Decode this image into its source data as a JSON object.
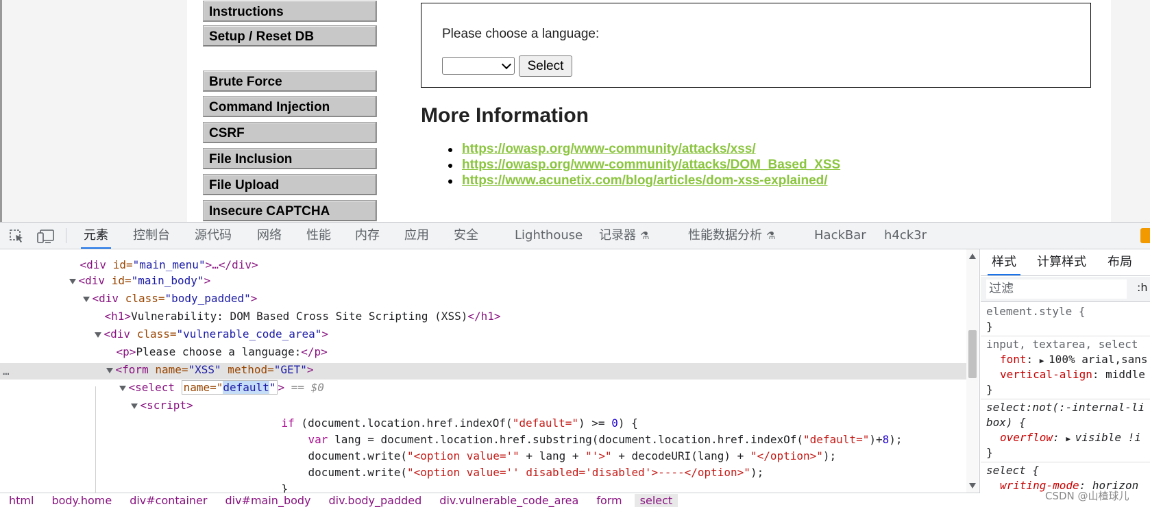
{
  "page": {
    "menu": [
      "Instructions",
      "Setup / Reset DB",
      "Brute Force",
      "Command Injection",
      "CSRF",
      "File Inclusion",
      "File Upload",
      "Insecure CAPTCHA"
    ],
    "prompt": "Please choose a language:",
    "select_button": "Select",
    "more_info_heading": "More Information",
    "links": [
      "https://owasp.org/www-community/attacks/xss/",
      "https://owasp.org/www-community/attacks/DOM_Based_XSS",
      "https://www.acunetix.com/blog/articles/dom-xss-explained/"
    ],
    "colors": {
      "link": "#8bc53f",
      "menu_bg": "#c8c8c8"
    }
  },
  "devtools": {
    "tabs": [
      "元素",
      "控制台",
      "源代码",
      "网络",
      "性能",
      "内存",
      "应用",
      "安全",
      "Lighthouse",
      "记录器",
      "性能数据分析",
      "HackBar",
      "h4ck3r"
    ],
    "active_tab": "元素",
    "flask_glyph": "⚗",
    "elements": {
      "l0": {
        "pre": "    ",
        "tag": "<div ",
        "attr": "id=",
        "val": "\"main_menu\"",
        "tail": ">…</div>"
      },
      "l1": {
        "tag1": "<div ",
        "attr": "id=",
        "val": "\"main_body\"",
        "tag2": ">"
      },
      "l2": {
        "tag1": "<div ",
        "attr": "class=",
        "val": "\"body_padded\"",
        "tag2": ">"
      },
      "l3": {
        "open": "<h1>",
        "text": "Vulnerability: DOM Based Cross Site Scripting (XSS)",
        "close": "</h1>"
      },
      "l4": {
        "tag1": "<div ",
        "attr": "class=",
        "val": "\"vulnerable_code_area\"",
        "tag2": ">"
      },
      "l5": {
        "open": "<p>",
        "text": "Please choose a language:",
        "close": "</p>"
      },
      "l6": {
        "tag1": "<form ",
        "attr1": "name=",
        "val1": "\"XSS\"",
        "attr2": " method=",
        "val2": "\"GET\"",
        "tag2": ">"
      },
      "l7": {
        "dots": "…",
        "tag1": "<select ",
        "edit_pre": "name=\"",
        "edit_hl": "default",
        "edit_post": "\"",
        "tag2": ">",
        "ref": " == $0"
      },
      "l8": {
        "tag": "<script>"
      },
      "code": [
        {
          "kw": "if",
          "rest1": " (document.location.href.indexOf(",
          "str1": "\"default=\"",
          "rest2": ") >= ",
          "num": "0",
          "rest3": ") {"
        },
        {
          "kw": "var",
          "rest1": " lang = document.location.href.substring(document.location.href.indexOf(",
          "str1": "\"default=\"",
          "rest2": ")+",
          "num": "8",
          "rest3": ");"
        },
        {
          "kw": "",
          "rest1": "document.write(",
          "str1": "\"<option value='\"",
          "rest2": " + lang + ",
          "num": "",
          "str2": "\"'>\"",
          "rest3": " + decodeURI(lang) + ",
          "str3": "\"</option>\"",
          "rest4": ");"
        },
        {
          "kw": "",
          "rest1": "document.write(",
          "str1": "\"<option value='' disabled='disabled'>----</option>\"",
          "rest2": ");",
          "num": "",
          "rest3": ""
        },
        {
          "kw": "",
          "rest1": "}",
          "str1": "",
          "rest2": "",
          "num": "",
          "rest3": ""
        }
      ]
    },
    "breadcrumbs": [
      "html",
      "body.home",
      "div#container",
      "div#main_body",
      "div.body_padded",
      "div.vulnerable_code_area",
      "form",
      "select"
    ],
    "styles": {
      "tabs": [
        "样式",
        "计算样式",
        "布局"
      ],
      "filter_placeholder": "过滤",
      "hov": ":h",
      "rules": [
        {
          "selector": "element.style {",
          "close": "}"
        },
        {
          "selector": "input, textarea, select",
          "props": [
            {
              "name": "font",
              "val": "100% arial,sans"
            },
            {
              "name": "vertical-align",
              "val": "middle"
            }
          ],
          "close": "}"
        },
        {
          "selector": "select:not(:-internal-li",
          "selector2": "box) {",
          "props": [
            {
              "name": "overflow",
              "val": "visible !i"
            }
          ],
          "close": "}"
        },
        {
          "selector": "select {",
          "props": [
            {
              "name": "writing-mode",
              "val": "horizon"
            }
          ]
        }
      ]
    },
    "watermark": "CSDN @山楂球儿"
  }
}
